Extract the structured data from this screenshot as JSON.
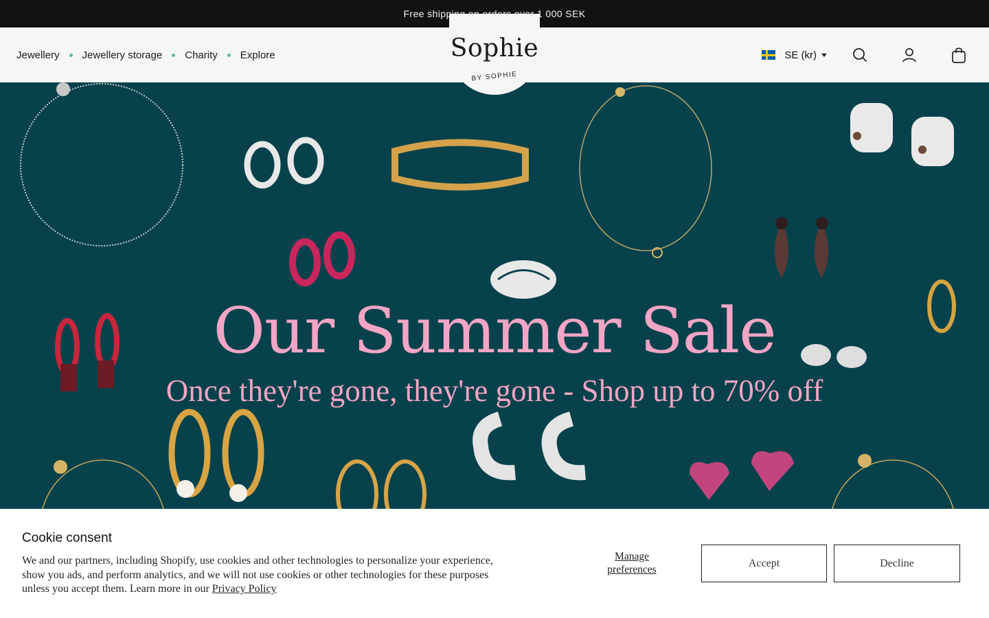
{
  "announcement": {
    "text": "Free shipping on orders over 1 000 SEK"
  },
  "header": {
    "nav": [
      {
        "label": "Jewellery"
      },
      {
        "label": "Jewellery storage"
      },
      {
        "label": "Charity"
      },
      {
        "label": "Explore"
      }
    ],
    "logo": {
      "name": "Sophie",
      "sub": "BY SOPHIE"
    },
    "currency": {
      "label": "SE (kr)",
      "flag": "sweden-flag"
    },
    "icons": [
      "search-icon",
      "account-icon",
      "bag-icon"
    ]
  },
  "hero": {
    "title": "Our Summer Sale",
    "subtitle": "Once they're gone, they're gone - Shop up to 70% off",
    "background": "#07424c",
    "accent": "#f2a5c5"
  },
  "cookie": {
    "title": "Cookie consent",
    "text": "We and our partners, including Shopify, use cookies and other technologies to personalize your experience, show you ads, and perform analytics, and we will not use cookies or other technologies for these purposes unless you accept them. Learn more in our",
    "link": "Privacy Policy",
    "manage": "Manage preferences",
    "accept": "Accept",
    "decline": "Decline"
  }
}
